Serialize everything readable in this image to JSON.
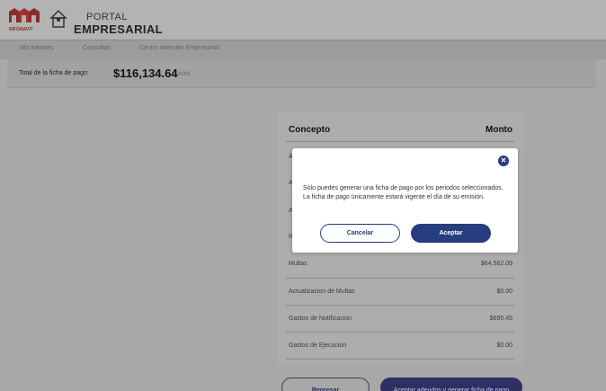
{
  "header": {
    "brand_small": "INFONAVIT",
    "portal_line1": "PORTAL",
    "portal_line2": "EMPRESARIAL"
  },
  "nav": {
    "items": [
      {
        "label": "Mis trámites"
      },
      {
        "label": "Consultas"
      },
      {
        "label": "Centro Atención Empresarial"
      }
    ]
  },
  "total": {
    "label": "Total de la ficha de pago:",
    "amount": "$116,134.64",
    "currency": "MXN"
  },
  "card": {
    "col_concept": "Concepto",
    "col_amount": "Monto",
    "hidden_row_initials": [
      "A",
      "A",
      "A",
      "R"
    ],
    "rows": [
      {
        "label": "Multas",
        "value": "$64,562.09"
      },
      {
        "label": "Actualizacion de Multas",
        "value": "$0.00"
      },
      {
        "label": "Gastos de Notificacion",
        "value": "$695.45"
      },
      {
        "label": "Gastos de Ejecucion",
        "value": "$0.00"
      }
    ]
  },
  "buttons": {
    "back": "Regresar",
    "accept_generate": "Aceptar adeudos y generar ficha de pago"
  },
  "modal": {
    "message": "Sólo puedes generar una ficha de pago por los periodos seleccionados. La ficha de pago únicamente estará vigente el día de su emisión.",
    "cancel": "Cancelar",
    "accept": "Aceptar"
  },
  "colors": {
    "primary": "#263d7e",
    "overlay_bg": "#a8a8a8"
  }
}
